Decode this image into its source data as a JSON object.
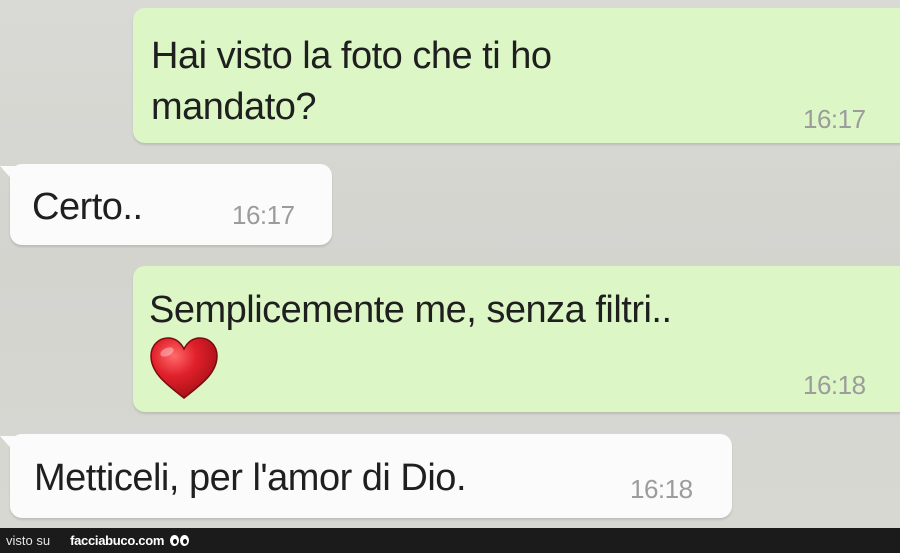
{
  "conversation": {
    "messages": [
      {
        "direction": "outgoing",
        "line1": "Hai visto la foto che ti ho",
        "line2": "mandato?",
        "time": "16:17"
      },
      {
        "direction": "incoming",
        "text": "Certo..",
        "time": "16:17"
      },
      {
        "direction": "outgoing",
        "text": "Semplicemente me, senza filtri..",
        "emoji": "heart-emoji",
        "time": "16:18"
      },
      {
        "direction": "incoming",
        "text": "Metticeli, per l'amor di Dio.",
        "time": "16:18"
      }
    ]
  },
  "colors": {
    "outgoing_bubble": "#dcf7c5",
    "incoming_bubble": "#fbfbfb",
    "chat_background": "#d6d6d2",
    "heart": "#e0202a"
  },
  "watermark": {
    "prefix": "visto su",
    "site": "facciabuco.com"
  }
}
